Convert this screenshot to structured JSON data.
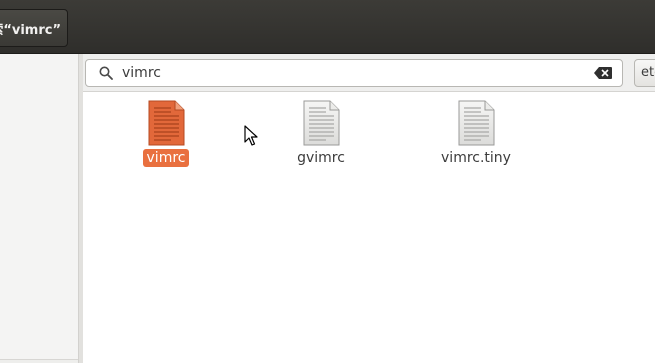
{
  "window": {
    "title_tab": "索“vimrc”"
  },
  "search": {
    "query": "vimrc",
    "location_button_label": "etc",
    "search_icon": "search-icon",
    "clear_icon": "clear-text-icon"
  },
  "results": {
    "files": [
      {
        "name": "vimrc",
        "selected": true,
        "icon": "text-document-icon"
      },
      {
        "name": "gvimrc",
        "selected": false,
        "icon": "text-document-icon"
      },
      {
        "name": "vimrc.tiny",
        "selected": false,
        "icon": "text-document-icon"
      }
    ]
  },
  "colors": {
    "selection": "#e9703f",
    "titlebar": "#3c3b37"
  }
}
